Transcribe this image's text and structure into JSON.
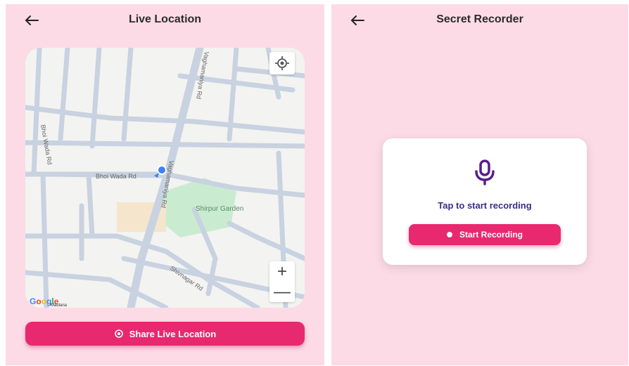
{
  "left_screen": {
    "title": "Live Location",
    "map": {
      "road_labels": [
        "Bhoi Wada Rd",
        "Bhoi Wada Rd",
        "Vaghamaniya Rd",
        "Vaghamaniya Rd",
        "Shivnagar Rd"
      ],
      "place_label": "Shirpur Garden",
      "zoom_in": "+",
      "zoom_out": "—",
      "attribution": "Google",
      "attribution_sub": "Maulana",
      "icons": [
        "my-location-icon",
        "current-position-marker-icon"
      ]
    },
    "share_button_label": "Share Live Location"
  },
  "right_screen": {
    "title": "Secret Recorder",
    "prompt": "Tap to start recording",
    "record_button_label": "Start Recording",
    "icons": [
      "microphone-icon",
      "record-dot-icon"
    ]
  },
  "colors": {
    "background": "#fcdbe6",
    "accent": "#e8286f",
    "mic": "#5a1c8a",
    "prompt_text": "#3a2c8c",
    "park": "#c9ecd0",
    "road": "#c8d2e0"
  }
}
